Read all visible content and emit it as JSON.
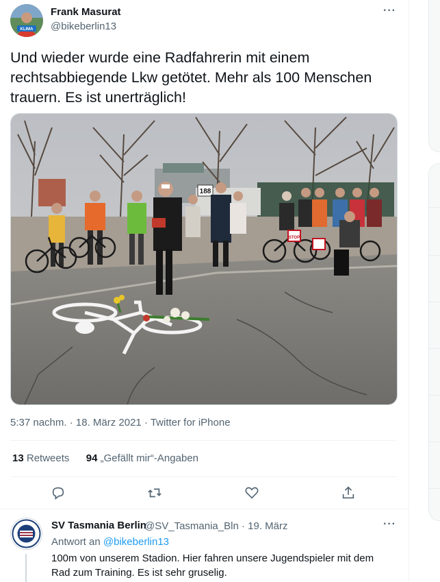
{
  "tweet": {
    "author_name": "Frank Masurat",
    "author_handle": "@bikeberlin13",
    "avatar_text": "KLIMA",
    "text": "Und wieder wurde eine Radfahrerin mit einem rechtsabbiegende Lkw getötet. Mehr als 100 Menschen trauern. Es ist unerträglich!",
    "time": "5:37 nachm. · 18. März 2021 · Twitter for iPhone",
    "retweets_count": "13",
    "retweets_label": "Retweets",
    "likes_count": "94",
    "likes_label": "„Gefällt mir“-Angaben",
    "more_label": "···"
  },
  "photo": {
    "sign_number": "188",
    "sign_text": "STOP"
  },
  "reply": {
    "author_name": "SV Tasmania Berlin",
    "meta": "@SV_Tasmania_Bln · 19. März",
    "reply_to_prefix": "Antwort an",
    "reply_to_handle": "@bikeberlin13",
    "text": "100m von unserem Stadion. Hier fahren unsere Jugendspieler mit dem Rad zum Training. Es ist sehr gruselig.",
    "more_label": "···"
  },
  "colors": {
    "accent": "#1d9bf0",
    "text": "#0f1419",
    "muted": "#536471",
    "border": "#eff3f4"
  },
  "icons": [
    "reply-icon",
    "retweet-icon",
    "like-icon",
    "share-icon",
    "more-icon"
  ]
}
